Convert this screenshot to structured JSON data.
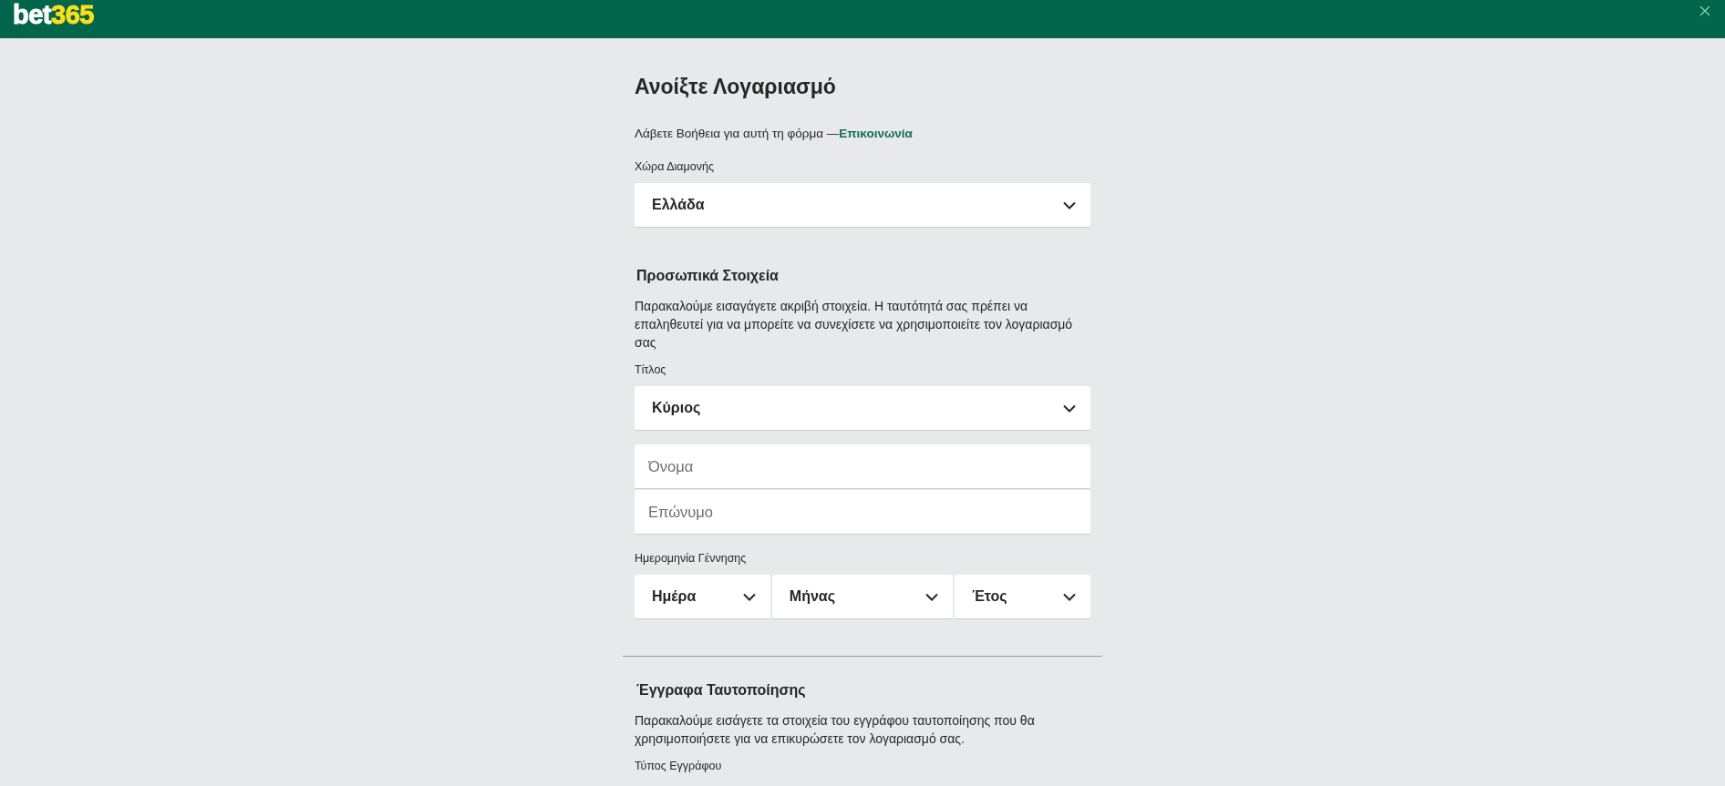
{
  "header": {
    "logo": {
      "main": "bet",
      "accent": "365"
    }
  },
  "form": {
    "title": "Ανοίξτε Λογαριασμό",
    "help": {
      "text": "Λάβετε Βοήθεια για αυτή τη φόρμα —",
      "link": "Επικοινωνία"
    },
    "sections": [
      {
        "items": [
          {
            "kind": "select",
            "label": "Χώρα Διαμονής",
            "value": "Ελλάδα"
          }
        ]
      },
      {
        "heading": "Προσωπικά Στοιχεία",
        "description": "Παρακαλούμε εισαγάγετε ακριβή στοιχεία. Η ταυτότητά σας πρέπει να επαληθευτεί για να μπορείτε να συνεχίσετε να χρησιμοποιείτε τον λογαριασμό σας",
        "items": [
          {
            "kind": "select",
            "label": "Τίτλος",
            "value": "Κύριος"
          },
          {
            "kind": "input",
            "placeholder": "Όνομα"
          },
          {
            "kind": "input",
            "placeholder": "Επώνυμο"
          },
          {
            "kind": "date",
            "label": "Ημερομηνία Γέννησης",
            "parts": [
              "Ημέρα",
              "Μήνας",
              "Έτος"
            ]
          }
        ]
      },
      {
        "heading": "Έγγραφα Ταυτοποίησης",
        "description": "Παρακαλούμε εισάγετε τα στοιχεία του εγγράφου ταυτοποίησης που θα χρησιμοποιήσετε για να επικυρώσετε τον λογαριασμό σας.",
        "divider": true,
        "items": [
          {
            "kind": "label",
            "label": "Τύπος Εγγράφου"
          }
        ]
      }
    ]
  }
}
